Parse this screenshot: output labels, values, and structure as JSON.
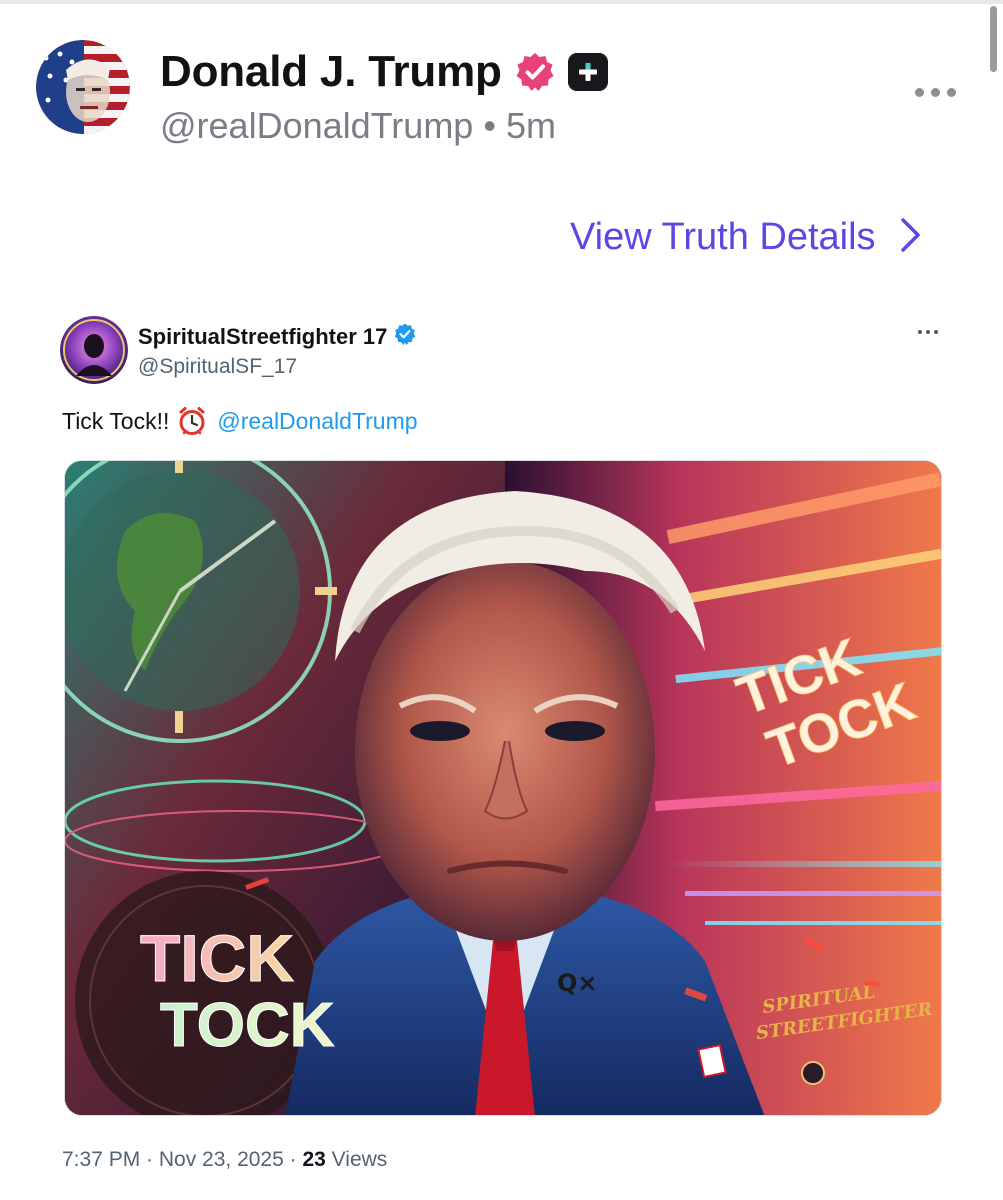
{
  "truth": {
    "display_name": "Donald J. Trump",
    "handle": "@realDonaldTrump",
    "separator": "•",
    "time_ago": "5m",
    "view_details_label": "View Truth Details"
  },
  "embedded_post": {
    "display_name": "SpiritualStreetfighter 17",
    "handle": "@SpiritualSF_17",
    "text": "Tick Tock!!",
    "mention": "@realDonaldTrump",
    "timestamp": "7:37 PM · Nov 23, 2025 ·",
    "views_count": "23",
    "views_label": "Views",
    "image_text": {
      "tick_left": "TICK",
      "tock_left": "TOCK",
      "tick_right": "TICK",
      "tock_right": "TOCK",
      "signature_line1": "SPIRITUAL",
      "signature_line2": "STREETFIGHTER",
      "collar_symbol": "Q×"
    }
  },
  "colors": {
    "accent": "#5a47e6",
    "verified_pink": "#e8427a",
    "x_blue": "#1d9bf0",
    "meta_gray": "#536471"
  },
  "icons": [
    "verified-badge-icon",
    "plus-badge-icon",
    "more-options-icon",
    "chevron-right-icon",
    "verified-check-icon",
    "alarm-clock-icon"
  ]
}
